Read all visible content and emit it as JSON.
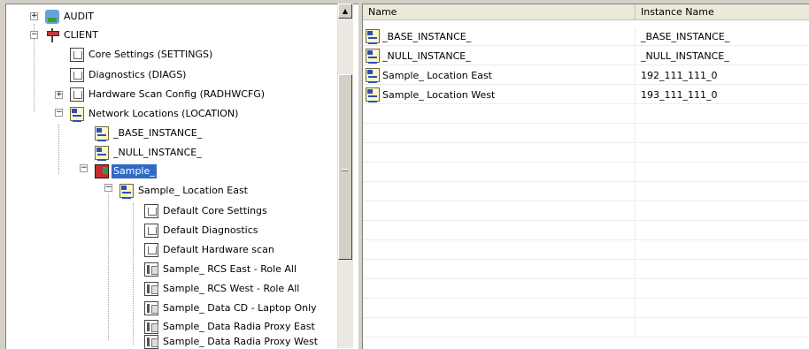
{
  "tree": {
    "nodes": [
      {
        "label": "AUDIT",
        "icon": "audit-icon"
      },
      {
        "label": "CLIENT",
        "icon": "client-icon"
      },
      {
        "label": "Core Settings (SETTINGS)",
        "icon": "page-icon"
      },
      {
        "label": "Diagnostics (DIAGS)",
        "icon": "page-icon"
      },
      {
        "label": "Hardware Scan Config (RADHWCFG)",
        "icon": "page-icon"
      },
      {
        "label": "Network Locations (LOCATION)",
        "icon": "instance-icon"
      },
      {
        "label": "_BASE_INSTANCE_",
        "icon": "instance-icon"
      },
      {
        "label": "_NULL_INSTANCE_",
        "icon": "instance-icon"
      },
      {
        "label": "Sample_",
        "icon": "sample-icon",
        "selected": true
      },
      {
        "label": "Sample_ Location East",
        "icon": "instance-icon"
      },
      {
        "label": "Default Core Settings",
        "icon": "page-icon"
      },
      {
        "label": "Default Diagnostics",
        "icon": "page-icon"
      },
      {
        "label": "Default Hardware scan",
        "icon": "page-icon"
      },
      {
        "label": "Sample_ RCS East - Role All",
        "icon": "service-icon"
      },
      {
        "label": "Sample_ RCS West - Role All",
        "icon": "service-icon"
      },
      {
        "label": "Sample_ Data CD - Laptop Only",
        "icon": "service-icon"
      },
      {
        "label": "Sample_ Data Radia Proxy East",
        "icon": "service-icon"
      },
      {
        "label": "Sample_ Data Radia Proxy West",
        "icon": "service-icon"
      }
    ],
    "expanders": [
      "+",
      "−",
      "+",
      "−",
      "−",
      "−"
    ]
  },
  "list": {
    "columns": [
      "Name",
      "Instance Name"
    ],
    "rows": [
      {
        "name": "_BASE_INSTANCE_",
        "instance": "_BASE_INSTANCE_",
        "icon": "instance-icon"
      },
      {
        "name": "_NULL_INSTANCE_",
        "instance": "_NULL_INSTANCE_",
        "icon": "instance-icon"
      },
      {
        "name": "Sample_ Location East",
        "instance": "192_111_111_0",
        "icon": "instance-icon"
      },
      {
        "name": "Sample_ Location West",
        "instance": "193_111_111_0",
        "icon": "instance-icon"
      }
    ]
  },
  "scrollbar": {
    "up_glyph": "▲"
  },
  "colors": {
    "selection": "#316ac5",
    "window_bg": "#d4d0c8"
  }
}
